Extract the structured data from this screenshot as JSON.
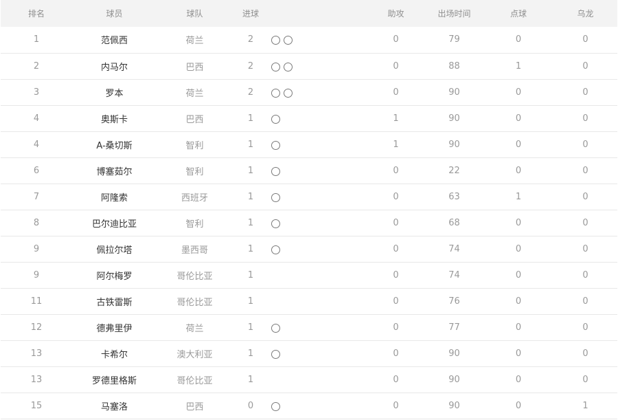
{
  "table": {
    "headers": {
      "rank": "排名",
      "player": "球员",
      "team": "球队",
      "goals": "进球",
      "assists": "助攻",
      "minutes": "出场时间",
      "penalties": "点球",
      "own_goals": "乌龙"
    },
    "rows": [
      {
        "rank": "1",
        "player": "范佩西",
        "team": "荷兰",
        "goals": "2",
        "ball_icons": 2,
        "assists": "0",
        "minutes": "79",
        "penalties": "0",
        "own_goals": "0"
      },
      {
        "rank": "2",
        "player": "内马尔",
        "team": "巴西",
        "goals": "2",
        "ball_icons": 2,
        "assists": "0",
        "minutes": "88",
        "penalties": "1",
        "own_goals": "0"
      },
      {
        "rank": "3",
        "player": "罗本",
        "team": "荷兰",
        "goals": "2",
        "ball_icons": 2,
        "assists": "0",
        "minutes": "90",
        "penalties": "0",
        "own_goals": "0"
      },
      {
        "rank": "4",
        "player": "奥斯卡",
        "team": "巴西",
        "goals": "1",
        "ball_icons": 1,
        "assists": "1",
        "minutes": "90",
        "penalties": "0",
        "own_goals": "0"
      },
      {
        "rank": "4",
        "player": "A-桑切斯",
        "team": "智利",
        "goals": "1",
        "ball_icons": 1,
        "assists": "1",
        "minutes": "90",
        "penalties": "0",
        "own_goals": "0"
      },
      {
        "rank": "6",
        "player": "博塞茹尔",
        "team": "智利",
        "goals": "1",
        "ball_icons": 1,
        "assists": "0",
        "minutes": "22",
        "penalties": "0",
        "own_goals": "0"
      },
      {
        "rank": "7",
        "player": "阿隆索",
        "team": "西班牙",
        "goals": "1",
        "ball_icons": 1,
        "assists": "0",
        "minutes": "63",
        "penalties": "1",
        "own_goals": "0"
      },
      {
        "rank": "8",
        "player": "巴尔迪比亚",
        "team": "智利",
        "goals": "1",
        "ball_icons": 1,
        "assists": "0",
        "minutes": "68",
        "penalties": "0",
        "own_goals": "0"
      },
      {
        "rank": "9",
        "player": "佩拉尔塔",
        "team": "墨西哥",
        "goals": "1",
        "ball_icons": 1,
        "assists": "0",
        "minutes": "74",
        "penalties": "0",
        "own_goals": "0"
      },
      {
        "rank": "9",
        "player": "阿尔梅罗",
        "team": "哥伦比亚",
        "goals": "1",
        "ball_icons": 0,
        "assists": "0",
        "minutes": "74",
        "penalties": "0",
        "own_goals": "0"
      },
      {
        "rank": "11",
        "player": "古铁雷斯",
        "team": "哥伦比亚",
        "goals": "1",
        "ball_icons": 0,
        "assists": "0",
        "minutes": "76",
        "penalties": "0",
        "own_goals": "0"
      },
      {
        "rank": "12",
        "player": "德弗里伊",
        "team": "荷兰",
        "goals": "1",
        "ball_icons": 1,
        "assists": "0",
        "minutes": "77",
        "penalties": "0",
        "own_goals": "0"
      },
      {
        "rank": "13",
        "player": "卡希尔",
        "team": "澳大利亚",
        "goals": "1",
        "ball_icons": 1,
        "assists": "0",
        "minutes": "90",
        "penalties": "0",
        "own_goals": "0"
      },
      {
        "rank": "13",
        "player": "罗德里格斯",
        "team": "哥伦比亚",
        "goals": "1",
        "ball_icons": 0,
        "assists": "0",
        "minutes": "90",
        "penalties": "0",
        "own_goals": "0"
      },
      {
        "rank": "15",
        "player": "马塞洛",
        "team": "巴西",
        "goals": "0",
        "ball_icons": 1,
        "assists": "0",
        "minutes": "90",
        "penalties": "0",
        "own_goals": "1"
      }
    ]
  },
  "icons": {
    "ball": "soccer-ball-icon"
  }
}
